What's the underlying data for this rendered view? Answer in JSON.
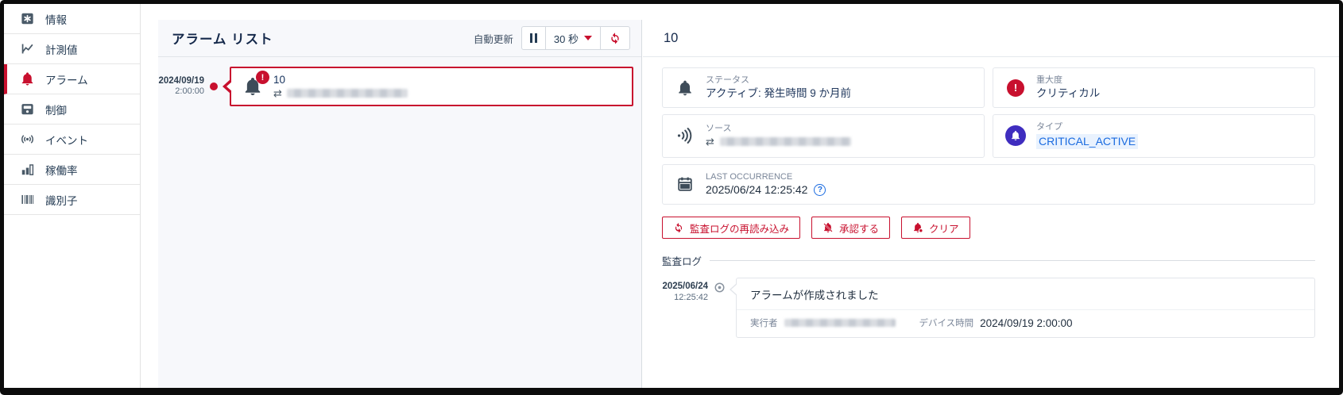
{
  "glyphs": {
    "exclamation": "!",
    "swap": "⇄",
    "help": "?"
  },
  "colors": {
    "accent_red": "#c8102e",
    "navy_text": "#15294b",
    "link_blue": "#1a6be0",
    "type_icon_bg": "#3f2dbf",
    "slate_icon": "#4a5a68",
    "list_panel_bg": "#f7f8fb",
    "card_border": "#e4e7ec"
  },
  "sidebar": {
    "items": [
      {
        "label": "情報",
        "icon": "info-square-icon",
        "active": false
      },
      {
        "label": "計測値",
        "icon": "line-chart-icon",
        "active": false
      },
      {
        "label": "アラーム",
        "icon": "bell-icon",
        "active": true
      },
      {
        "label": "制御",
        "icon": "control-meter-icon",
        "active": false
      },
      {
        "label": "イベント",
        "icon": "broadcast-icon",
        "active": false
      },
      {
        "label": "稼働率",
        "icon": "bar-chart-icon",
        "active": false
      },
      {
        "label": "識別子",
        "icon": "barcode-icon",
        "active": false
      }
    ]
  },
  "alarm_list": {
    "title": "アラーム リスト",
    "auto_refresh_label": "自動更新",
    "refresh_interval": "30 秒",
    "entries": [
      {
        "date": "2024/09/19",
        "time": "2:00:00",
        "title": "10",
        "source_redacted": true,
        "severity": "critical"
      }
    ]
  },
  "detail": {
    "title": "10",
    "status": {
      "label": "ステータス",
      "value": "アクティブ: 発生時間 9 か月前"
    },
    "severity": {
      "label": "重大度",
      "value": "クリティカル"
    },
    "source": {
      "label": "ソース",
      "redacted": true
    },
    "type": {
      "label": "タイプ",
      "value": "CRITICAL_ACTIVE"
    },
    "last_occurrence": {
      "label": "LAST OCCURRENCE",
      "value": "2025/06/24 12:25:42"
    },
    "actions": {
      "reload_audit": "監査ログの再読み込み",
      "acknowledge": "承認する",
      "clear": "クリア"
    },
    "audit_log": {
      "section_label": "監査ログ",
      "entries": [
        {
          "date": "2025/06/24",
          "time": "12:25:42",
          "message": "アラームが作成されました",
          "executor_label": "実行者",
          "executor_redacted": true,
          "device_time_label": "デバイス時間",
          "device_time": "2024/09/19 2:00:00"
        }
      ]
    }
  }
}
